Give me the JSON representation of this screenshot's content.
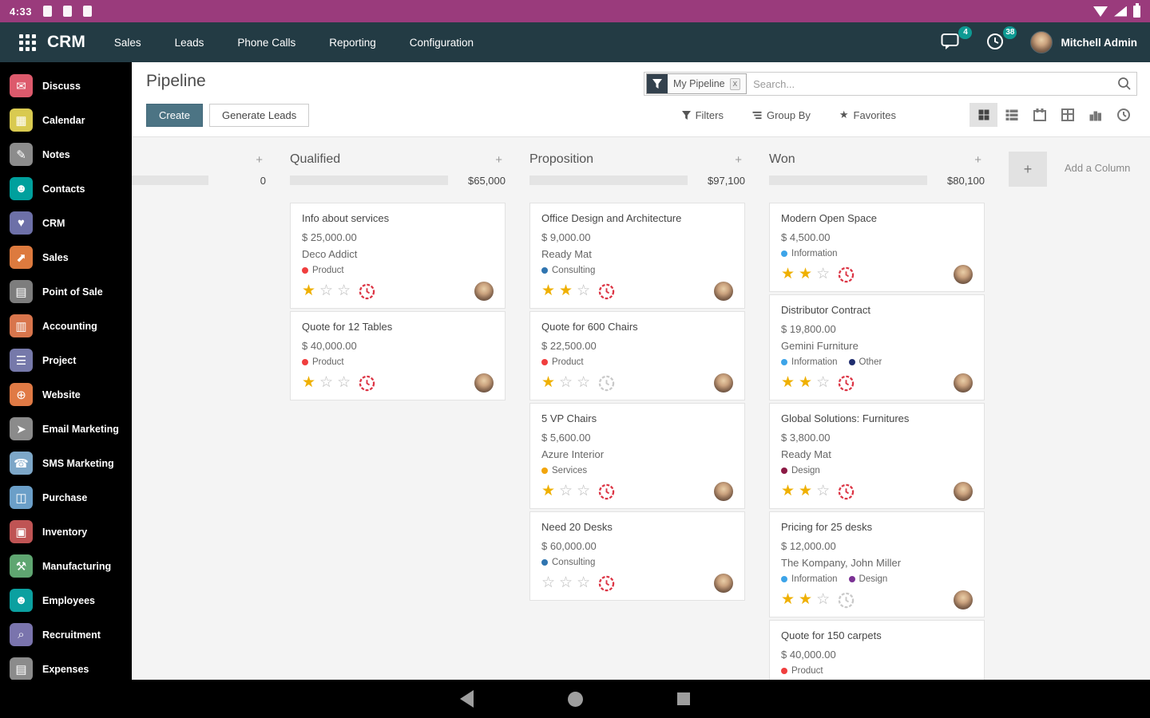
{
  "status_bar": {
    "time": "4:33"
  },
  "navbar": {
    "app_name": "CRM",
    "menus": [
      "Sales",
      "Leads",
      "Phone Calls",
      "Reporting",
      "Configuration"
    ],
    "messages_badge": "4",
    "activities_badge": "38",
    "user_name": "Mitchell Admin"
  },
  "sidebar": {
    "items": [
      {
        "label": "Discuss",
        "color": "#dd5a6c",
        "glyph": "✉"
      },
      {
        "label": "Calendar",
        "color": "#d9ca50",
        "glyph": "▦"
      },
      {
        "label": "Notes",
        "color": "#8c8c8c",
        "glyph": "✎"
      },
      {
        "label": "Contacts",
        "color": "#00a09d",
        "glyph": "☻"
      },
      {
        "label": "CRM",
        "color": "#6d70a8",
        "glyph": "♥"
      },
      {
        "label": "Sales",
        "color": "#dd7a3e",
        "glyph": "⬈"
      },
      {
        "label": "Point of Sale",
        "color": "#7d7d7d",
        "glyph": "▤"
      },
      {
        "label": "Accounting",
        "color": "#d8754c",
        "glyph": "▥"
      },
      {
        "label": "Project",
        "color": "#7679aa",
        "glyph": "☰"
      },
      {
        "label": "Website",
        "color": "#e07a45",
        "glyph": "⊕"
      },
      {
        "label": "Email Marketing",
        "color": "#8b8b8b",
        "glyph": "➤"
      },
      {
        "label": "SMS Marketing",
        "color": "#7da7c8",
        "glyph": "☎"
      },
      {
        "label": "Purchase",
        "color": "#6b9fc8",
        "glyph": "◫"
      },
      {
        "label": "Inventory",
        "color": "#bf5454",
        "glyph": "▣"
      },
      {
        "label": "Manufacturing",
        "color": "#5fa671",
        "glyph": "⚒"
      },
      {
        "label": "Employees",
        "color": "#0ba0a0",
        "glyph": "☻"
      },
      {
        "label": "Recruitment",
        "color": "#7a74ad",
        "glyph": "⌕"
      },
      {
        "label": "Expenses",
        "color": "#8b8b8b",
        "glyph": "▤"
      }
    ]
  },
  "control_panel": {
    "title": "Pipeline",
    "create_label": "Create",
    "generate_label": "Generate Leads",
    "facet_label": "My Pipeline",
    "facet_remove": "x",
    "search_placeholder": "Search...",
    "filters_label": "Filters",
    "group_by_label": "Group By",
    "favorites_label": "Favorites",
    "view_switcher": [
      "kanban",
      "list",
      "calendar",
      "pivot",
      "graph",
      "activity"
    ],
    "active_view": "kanban"
  },
  "board": {
    "partial_column": {
      "count": "0",
      "progress_pct": 0
    },
    "add_column_label": "Add a Column",
    "columns": [
      {
        "name": "Qualified",
        "amount": "$65,000",
        "progress_pct": 100,
        "cards": [
          {
            "title": "Info about services",
            "amount": "$ 25,000.00",
            "partner": "Deco Addict",
            "tags": [
              {
                "label": "Product",
                "color": "#f03e3e"
              }
            ],
            "stars": 1,
            "clock": "red"
          },
          {
            "title": "Quote for 12 Tables",
            "amount": "$ 40,000.00",
            "partner": "",
            "tags": [
              {
                "label": "Product",
                "color": "#f03e3e"
              }
            ],
            "stars": 1,
            "clock": "red"
          }
        ]
      },
      {
        "name": "Proposition",
        "amount": "$97,100",
        "progress_pct": 88,
        "cards": [
          {
            "title": "Office Design and Architecture",
            "amount": "$ 9,000.00",
            "partner": "Ready Mat",
            "tags": [
              {
                "label": "Consulting",
                "color": "#3075b0"
              }
            ],
            "stars": 2,
            "clock": "red"
          },
          {
            "title": "Quote for 600 Chairs",
            "amount": "$ 22,500.00",
            "partner": "",
            "tags": [
              {
                "label": "Product",
                "color": "#f03e3e"
              }
            ],
            "stars": 1,
            "clock": "gray"
          },
          {
            "title": "5 VP Chairs",
            "amount": "$ 5,600.00",
            "partner": "Azure Interior",
            "tags": [
              {
                "label": "Services",
                "color": "#f2a50c"
              }
            ],
            "stars": 1,
            "clock": "red"
          },
          {
            "title": "Need 20 Desks",
            "amount": "$ 60,000.00",
            "partner": "",
            "tags": [
              {
                "label": "Consulting",
                "color": "#3075b0"
              }
            ],
            "stars": 0,
            "clock": "red"
          }
        ]
      },
      {
        "name": "Won",
        "amount": "$80,100",
        "progress_pct": 63,
        "cards": [
          {
            "title": "Modern Open Space",
            "amount": "$ 4,500.00",
            "partner": "",
            "tags": [
              {
                "label": "Information",
                "color": "#3da4e8"
              }
            ],
            "stars": 2,
            "clock": "red"
          },
          {
            "title": "Distributor Contract",
            "amount": "$ 19,800.00",
            "partner": "Gemini Furniture",
            "tags": [
              {
                "label": "Information",
                "color": "#3da4e8"
              },
              {
                "label": "Other",
                "color": "#1f2d6e"
              }
            ],
            "stars": 2,
            "clock": "red"
          },
          {
            "title": "Global Solutions: Furnitures",
            "amount": "$ 3,800.00",
            "partner": "Ready Mat",
            "tags": [
              {
                "label": "Design",
                "color": "#8c1a45"
              }
            ],
            "stars": 2,
            "clock": "red"
          },
          {
            "title": "Pricing for 25 desks",
            "amount": "$ 12,000.00",
            "partner": "The Kompany, John Miller",
            "tags": [
              {
                "label": "Information",
                "color": "#3da4e8"
              },
              {
                "label": "Design",
                "color": "#7b3294"
              }
            ],
            "stars": 2,
            "clock": "gray"
          },
          {
            "title": "Quote for 150 carpets",
            "amount": "$ 40,000.00",
            "partner": "",
            "tags": [
              {
                "label": "Product",
                "color": "#f03e3e"
              }
            ],
            "stars": 0,
            "clock": "red"
          }
        ]
      }
    ]
  },
  "colors": {
    "status_bar": "#9a3b7c",
    "navbar": "#233b44",
    "accent_teal": "#0e9a93",
    "progress_red": "#dc3545",
    "star_gold": "#efb000",
    "create_button": "#4c7484"
  }
}
